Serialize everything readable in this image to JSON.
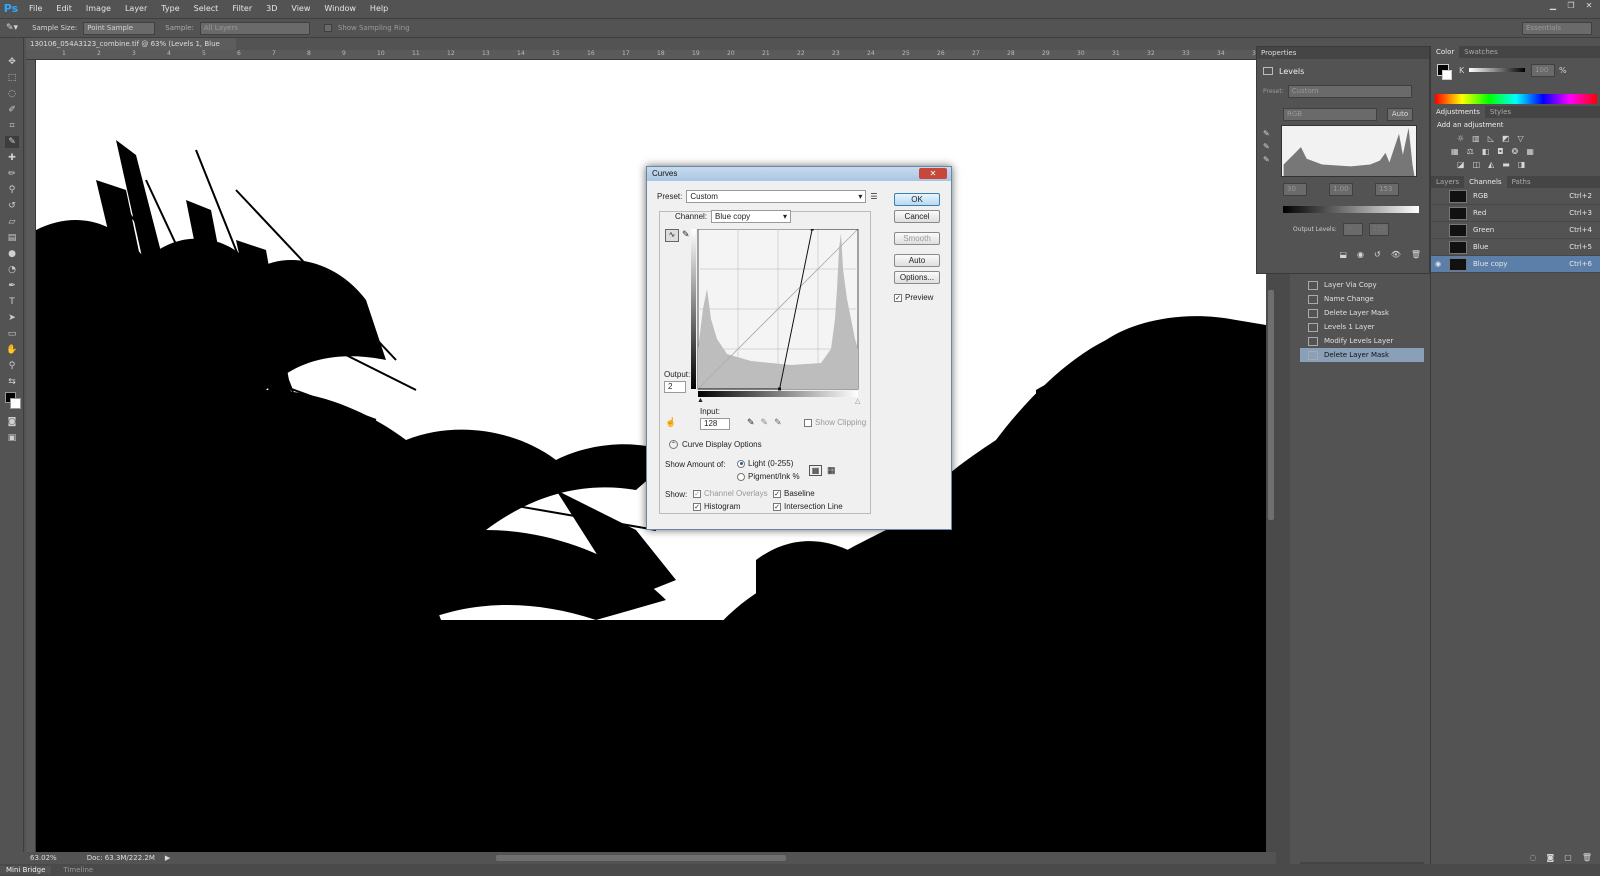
{
  "app": {
    "logo": "Ps",
    "menu": [
      "File",
      "Edit",
      "Image",
      "Layer",
      "Type",
      "Select",
      "Filter",
      "3D",
      "View",
      "Window",
      "Help"
    ],
    "workspace": "Essentials"
  },
  "options": {
    "sample_size_label": "Sample Size:",
    "sample_size_value": "Point Sample",
    "sample_label": "Sample:",
    "sample_value": "All Layers",
    "show_ring": "Show Sampling Ring"
  },
  "document": {
    "tab_title": "130106_054A3123_combine.tif @ 63% (Levels 1, Blue copy/8) *",
    "ruler_ticks": [
      "1",
      "2",
      "3",
      "4",
      "5",
      "6",
      "7",
      "8",
      "9",
      "10",
      "11",
      "12",
      "13",
      "14",
      "15",
      "16",
      "17",
      "18",
      "19",
      "20",
      "21",
      "22",
      "23",
      "24",
      "25",
      "26",
      "27",
      "28",
      "29",
      "30",
      "31",
      "32",
      "33",
      "34",
      "35"
    ],
    "zoom": "63.02%",
    "doc_size": "Doc: 63.3M/222.2M"
  },
  "bottom_tabs": [
    "Mini Bridge",
    "Timeline"
  ],
  "properties": {
    "panel_title": "Properties",
    "type": "Levels",
    "preset_label": "Preset:",
    "preset_value": "Custom",
    "channel_value": "RGB",
    "auto_label": "Auto",
    "input_black": "30",
    "input_gamma": "1.00",
    "input_white": "153",
    "output_label": "Output Levels:",
    "output_black": "0",
    "output_white": "255"
  },
  "history": {
    "items": [
      "Layer Via Copy",
      "Name Change",
      "Delete Layer Mask",
      "Levels 1 Layer",
      "Modify Levels Layer",
      "Delete Layer Mask"
    ],
    "selected": 5
  },
  "color_panel": {
    "tabs": [
      "Color",
      "Swatches"
    ],
    "k_label": "K",
    "k_value": "100",
    "k_unit": "%"
  },
  "adjustments": {
    "tabs": [
      "Adjustments",
      "Styles"
    ],
    "heading": "Add an adjustment"
  },
  "channels": {
    "tabs": [
      "Layers",
      "Channels",
      "Paths"
    ],
    "rows": [
      {
        "name": "RGB",
        "shortcut": "Ctrl+2"
      },
      {
        "name": "Red",
        "shortcut": "Ctrl+3"
      },
      {
        "name": "Green",
        "shortcut": "Ctrl+4"
      },
      {
        "name": "Blue",
        "shortcut": "Ctrl+5"
      },
      {
        "name": "Blue copy",
        "shortcut": "Ctrl+6"
      }
    ]
  },
  "curves": {
    "title": "Curves",
    "close": "✕",
    "preset_label": "Preset:",
    "preset_value": "Custom",
    "channel_label": "Channel:",
    "channel_value": "Blue copy",
    "ok": "OK",
    "cancel": "Cancel",
    "smooth": "Smooth",
    "auto": "Auto",
    "options": "Options...",
    "preview_label": "Preview",
    "output_label": "Output:",
    "output_value": "2",
    "input_label": "Input:",
    "input_value": "128",
    "show_clipping": "Show Clipping",
    "display_options": "Curve Display Options",
    "show_amount_label": "Show Amount of:",
    "light": "Light  (0-255)",
    "pigment": "Pigment/Ink %",
    "show_label": "Show:",
    "channel_overlays": "Channel Overlays",
    "baseline": "Baseline",
    "histogram": "Histogram",
    "intersection": "Intersection Line",
    "curve_points": [
      {
        "input": 0,
        "output": 0
      },
      {
        "input": 130,
        "output": 0
      },
      {
        "input": 182,
        "output": 255
      },
      {
        "input": 255,
        "output": 255
      }
    ]
  }
}
